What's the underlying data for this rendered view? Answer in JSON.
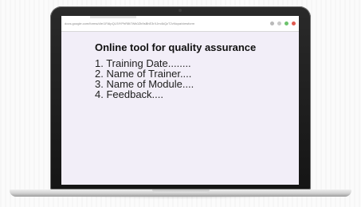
{
  "browser": {
    "url": "docs.google.com/forms/d/e/1FAIpQLSfYPhR8t7Wk0Zb9sBhE3rXJm4kQzT2vNcpa/viewform",
    "icons": [
      "zoom-icon",
      "star-icon",
      "extension-icon",
      "menu-icon"
    ],
    "icon_colors": [
      "#b9b9b9",
      "#c8c8c8",
      "#6cc26c",
      "#e05a4f"
    ]
  },
  "page": {
    "title": "Online tool for quality assurance",
    "items": [
      "1. Training Date........",
      "2. Name of Trainer....",
      "3. Name of Module....",
      "4. Feedback...."
    ]
  }
}
